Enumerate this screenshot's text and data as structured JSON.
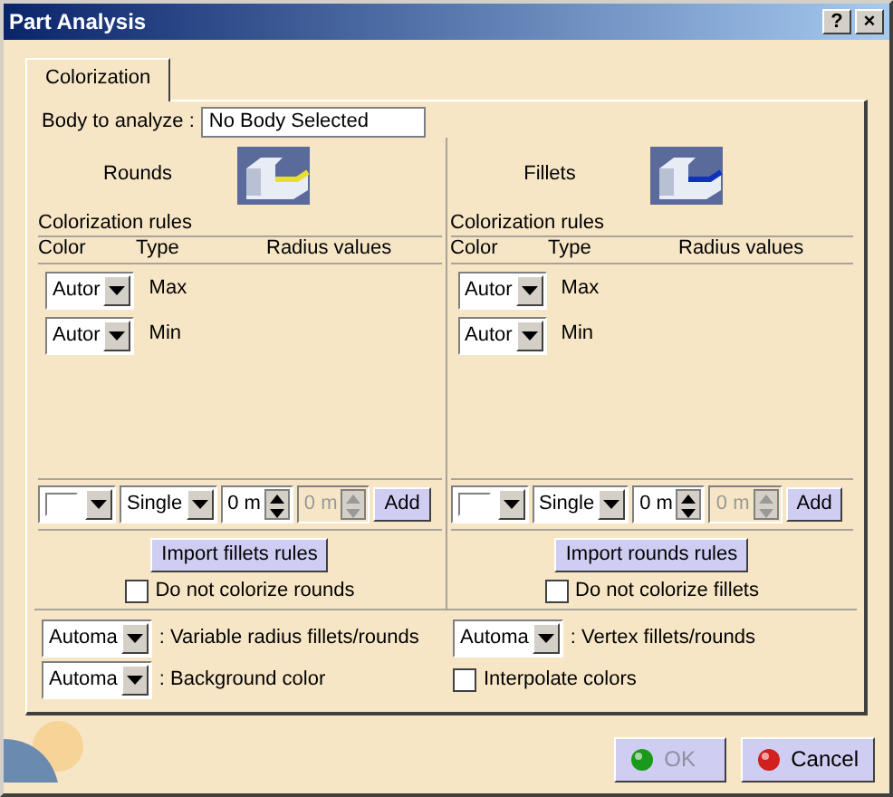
{
  "window": {
    "title": "Part Analysis",
    "controls": [
      "?",
      "×"
    ]
  },
  "tabs": [
    {
      "label": "Colorization",
      "selected": true
    }
  ],
  "body_field": {
    "label": "Body to analyze :",
    "value": "No Body Selected"
  },
  "panels": [
    {
      "title": "Rounds",
      "kind": "round",
      "rules_label": "Colorization rules",
      "columns": [
        "Color",
        "Type",
        "Radius values"
      ],
      "rules": [
        {
          "value": "Autor",
          "type": "Max"
        },
        {
          "value": "Autor",
          "type": "Min"
        }
      ],
      "editor": {
        "type": "Single",
        "value": "0 m",
        "value_2": "0 m",
        "value_2_disabled": true,
        "button": "Add"
      },
      "import_button": "Import fillets rules",
      "checkbox": {
        "label": "Do not colorize rounds",
        "checked": false
      }
    },
    {
      "title": "Fillets",
      "kind": "fillet",
      "rules_label": "Colorization rules",
      "columns": [
        "Color",
        "Type",
        "Radius values"
      ],
      "rules": [
        {
          "value": "Autor",
          "type": "Max"
        },
        {
          "value": "Autor",
          "type": "Min"
        }
      ],
      "editor": {
        "type": "Single",
        "value": "0 m",
        "value_2": "0 m",
        "value_2_disabled": true,
        "button": "Add"
      },
      "import_button": "Import rounds rules",
      "checkbox": {
        "label": "Do not colorize fillets",
        "checked": false
      }
    }
  ],
  "options": [
    {
      "kind": "combo",
      "value": "Automa",
      "label": ": Variable radius fillets/rounds"
    },
    {
      "kind": "combo",
      "value": "Automa",
      "label": ": Vertex fillets/rounds"
    },
    {
      "kind": "combo",
      "value": "Automa",
      "label": ": Background color"
    },
    {
      "kind": "checkbox",
      "label": "Interpolate colors",
      "checked": false
    }
  ],
  "buttons": [
    {
      "kind": "ok",
      "label": "OK",
      "disabled": true
    },
    {
      "kind": "cancel",
      "label": "Cancel",
      "disabled": false
    }
  ]
}
